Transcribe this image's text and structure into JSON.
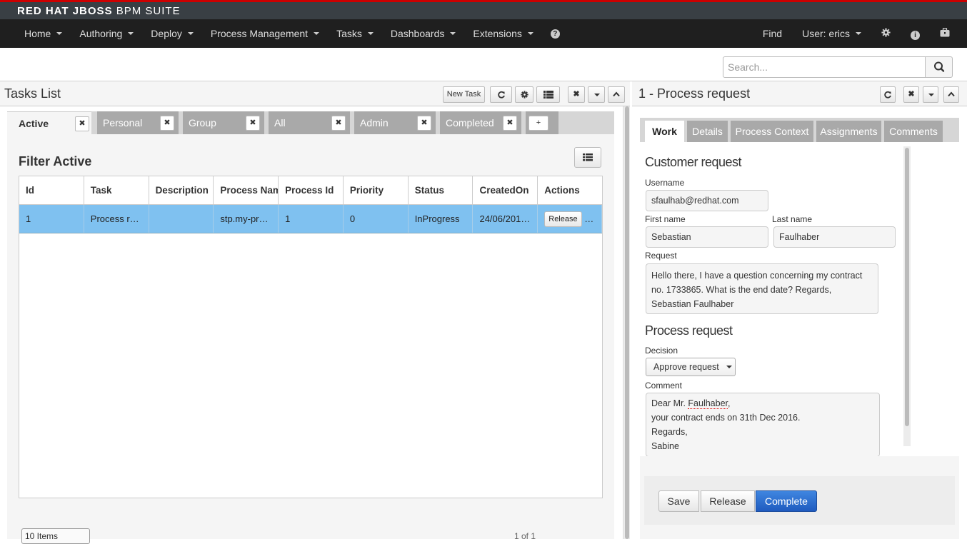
{
  "brand": {
    "bold": "RED HAT JBOSS",
    "rest": "BPM SUITE"
  },
  "nav": {
    "items": [
      "Home",
      "Authoring",
      "Deploy",
      "Process Management",
      "Tasks",
      "Dashboards",
      "Extensions"
    ],
    "help_icon": "question-circle-icon",
    "find": "Find",
    "user": "User: erics",
    "icons": [
      "gear-icon",
      "info-icon",
      "briefcase-icon"
    ]
  },
  "search": {
    "placeholder": "Search...",
    "value": ""
  },
  "left_panel": {
    "title": "Tasks List",
    "new_task": "New Task",
    "tabs": [
      "Active",
      "Personal",
      "Group",
      "All",
      "Admin",
      "Completed"
    ],
    "add_tab": "+",
    "filter_title": "Filter Active",
    "columns": [
      "Id",
      "Task",
      "Description",
      "Process Nam",
      "Process Id",
      "Priority",
      "Status",
      "CreatedOn",
      "Actions"
    ],
    "rows": [
      {
        "id": "1",
        "task": "Process r…",
        "description": "",
        "process_name": "stp.my-pr…",
        "process_id": "1",
        "priority": "0",
        "status": "InProgress",
        "created_on": "24/06/201…",
        "action": "Release",
        "more": "…"
      }
    ],
    "page_size": "10 Items",
    "pager": "1 of 1"
  },
  "right_panel": {
    "title": "1 - Process request",
    "tabs": [
      "Work",
      "Details",
      "Process Context",
      "Assignments",
      "Comments"
    ],
    "form": {
      "section1": "Customer request",
      "username_label": "Username",
      "username": "sfaulhab@redhat.com",
      "firstname_label": "First name",
      "firstname": "Sebastian",
      "lastname_label": "Last name",
      "lastname": "Faulhaber",
      "request_label": "Request",
      "request": "Hello there, I have a question concerning my contract no. 1733865. What is the end date? Regards, Sebastian Faulhaber",
      "section2": "Process request",
      "decision_label": "Decision",
      "decision": "Approve request",
      "comment_label": "Comment",
      "comment_lines": [
        "Dear Mr. ",
        "Faulhaber",
        ",",
        "your contract ends on 31th Dec 2016.",
        "Regards,",
        "Sabine"
      ]
    },
    "buttons": {
      "save": "Save",
      "release": "Release",
      "complete": "Complete"
    }
  },
  "colors": {
    "accent_red": "#cc0000",
    "selected_row": "#7fc1f0",
    "primary_button": "#2a6fd6",
    "navbar": "#1f1f1f"
  }
}
